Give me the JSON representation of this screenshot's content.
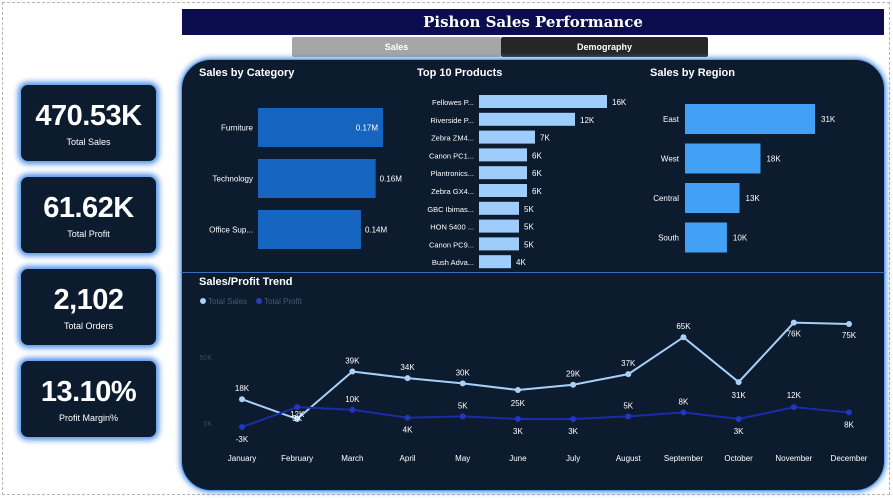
{
  "header": {
    "title": "Pishon Sales Performance"
  },
  "tabs": [
    {
      "label": "Sales"
    },
    {
      "label": "Demography"
    }
  ],
  "kpis": [
    {
      "value": "470.53K",
      "label": "Total Sales"
    },
    {
      "value": "61.62K",
      "label": "Total Profit"
    },
    {
      "value": "2,102",
      "label": "Total Orders"
    },
    {
      "value": "13.10%",
      "label": "Profit Margin%"
    }
  ],
  "colors": {
    "title_bg": "#0b0d4f",
    "panel_bg": "#0c1b2e",
    "cat_bar": "#1565c0",
    "prod_bar": "#9fcdfb",
    "region_bar": "#42a0f5",
    "sales_line": "#a9d0f7",
    "profit_line": "#1a2ca8"
  },
  "chart_data": [
    {
      "type": "bar",
      "orientation": "horizontal",
      "title": "Sales by Category",
      "categories": [
        "Furniture",
        "Technology",
        "Office Sup..."
      ],
      "values": [
        0.17,
        0.16,
        0.14
      ],
      "data_labels": [
        "0.17M",
        "0.16M",
        "0.14M"
      ]
    },
    {
      "type": "bar",
      "orientation": "horizontal",
      "title": "Top 10 Products",
      "categories": [
        "Fellowes P...",
        "Riverside P...",
        "Zebra ZM4...",
        "Canon PC1...",
        "Plantronics...",
        "Zebra GX4...",
        "GBC Ibimas...",
        "HON 5400 ...",
        "Canon PC9...",
        "Bush Adva..."
      ],
      "values": [
        16,
        12,
        7,
        6,
        6,
        6,
        5,
        5,
        5,
        4
      ],
      "data_labels": [
        "16K",
        "12K",
        "7K",
        "6K",
        "6K",
        "6K",
        "5K",
        "5K",
        "5K",
        "4K"
      ]
    },
    {
      "type": "bar",
      "orientation": "horizontal",
      "title": "Sales by Region",
      "categories": [
        "East",
        "West",
        "Central",
        "South"
      ],
      "values": [
        31,
        18,
        13,
        10
      ],
      "data_labels": [
        "31K",
        "18K",
        "13K",
        "10K"
      ]
    },
    {
      "type": "line",
      "title": "Sales/Profit Trend",
      "x": [
        "January",
        "February",
        "March",
        "April",
        "May",
        "June",
        "July",
        "August",
        "September",
        "October",
        "November",
        "December"
      ],
      "yticks": [
        "50K",
        "0K"
      ],
      "legend_position": "top-left",
      "series": [
        {
          "name": "Total Sales",
          "values": [
            18,
            3,
            39,
            34,
            30,
            25,
            29,
            37,
            65,
            31,
            76,
            75
          ],
          "labels": [
            "18K",
            "3K",
            "39K",
            "34K",
            "30K",
            "25K",
            "29K",
            "37K",
            "65K",
            "31K",
            "76K",
            "75K"
          ]
        },
        {
          "name": "Total Profit",
          "values": [
            -3,
            12,
            10,
            4,
            5,
            3,
            3,
            5,
            8,
            3,
            12,
            8
          ],
          "labels": [
            "-3K",
            "12K",
            "10K",
            "4K",
            "5K",
            "3K",
            "3K",
            "5K",
            "8K",
            "3K",
            "12K",
            "8K"
          ]
        }
      ]
    }
  ]
}
